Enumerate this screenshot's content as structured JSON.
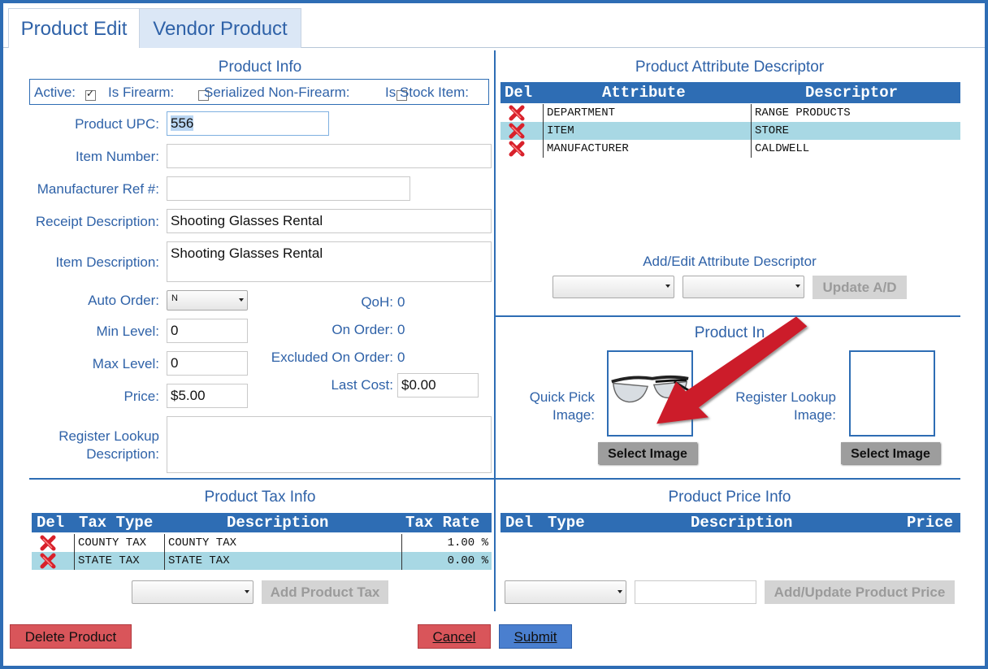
{
  "tabs": [
    {
      "label": "Product Edit"
    },
    {
      "label": "Vendor Product"
    }
  ],
  "product_info": {
    "title": "Product Info",
    "checkboxes": [
      {
        "label": "Active:",
        "checked": true
      },
      {
        "label": "Is Firearm:",
        "checked": false
      },
      {
        "label": "Serialized Non-Firearm:",
        "checked": false
      },
      {
        "label": "Is Stock Item:",
        "checked": false
      }
    ],
    "upc_label": "Product UPC:",
    "upc_value": "556",
    "item_number_label": "Item Number:",
    "item_number_value": "",
    "mfr_ref_label": "Manufacturer Ref #:",
    "mfr_ref_value": "",
    "receipt_desc_label": "Receipt Description:",
    "receipt_desc_value": "Shooting Glasses Rental",
    "item_desc_label": "Item Description:",
    "item_desc_value": "Shooting Glasses Rental",
    "auto_order_label": "Auto Order:",
    "auto_order_value": "N",
    "min_level_label": "Min Level:",
    "min_level_value": "0",
    "max_level_label": "Max Level:",
    "max_level_value": "0",
    "price_label": "Price:",
    "price_value": "$5.00",
    "register_lookup_label_1": "Register Lookup",
    "register_lookup_label_2": "Description:",
    "register_lookup_value": "",
    "qoh_label": "QoH:",
    "qoh_value": "0",
    "on_order_label": "On Order:",
    "on_order_value": "0",
    "excluded_label": "Excluded On Order:",
    "excluded_value": "0",
    "last_cost_label": "Last Cost:",
    "last_cost_value": "$0.00"
  },
  "attribute_descriptor": {
    "title": "Product Attribute Descriptor",
    "headers": {
      "del": "Del",
      "attribute": "Attribute",
      "descriptor": "Descriptor"
    },
    "rows": [
      {
        "attribute": "DEPARTMENT",
        "descriptor": "RANGE PRODUCTS"
      },
      {
        "attribute": "ITEM",
        "descriptor": "STORE"
      },
      {
        "attribute": "MANUFACTURER",
        "descriptor": "CALDWELL"
      }
    ],
    "add_edit_title": "Add/Edit Attribute Descriptor",
    "update_button": "Update A/D"
  },
  "product_image": {
    "title": "Product In",
    "quick_pick_label_1": "Quick Pick",
    "quick_pick_label_2": "Image:",
    "register_label_1": "Register Lookup",
    "register_label_2": "Image:",
    "select_image_1": "Select Image",
    "select_image_2": "Select Image"
  },
  "tax_info": {
    "title": "Product Tax Info",
    "headers": {
      "del": "Del",
      "tax_type": "Tax Type",
      "description": "Description",
      "tax_rate": "Tax Rate"
    },
    "rows": [
      {
        "tax_type": "COUNTY TAX",
        "description": "COUNTY TAX",
        "tax_rate": "1.00 %"
      },
      {
        "tax_type": "STATE TAX",
        "description": "STATE TAX",
        "tax_rate": "0.00 %"
      }
    ],
    "add_button": "Add Product Tax"
  },
  "price_info": {
    "title": "Product Price Info",
    "headers": {
      "del": "Del",
      "type": "Type",
      "description": "Description",
      "price": "Price"
    },
    "add_button": "Add/Update Product Price"
  },
  "footer": {
    "delete_button": "Delete Product",
    "cancel_button": "Cancel",
    "submit_button": "Submit"
  },
  "colors": {
    "accent": "#2e6db4",
    "label_text": "#2f62a8",
    "alt_row": "#a8d8e4",
    "delete_red": "#d9555a",
    "annotation_arrow": "#cc1f2a"
  }
}
